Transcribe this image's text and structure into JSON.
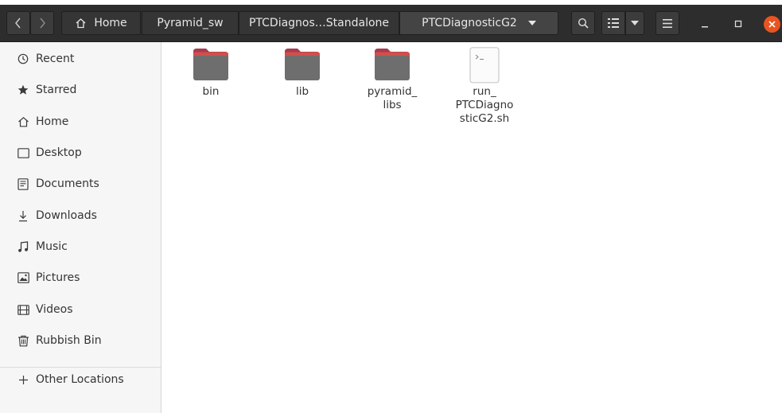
{
  "header": {
    "home_label": "Home",
    "breadcrumbs": [
      "Pyramid_sw",
      "PTCDiagnos…Standalone",
      "PTCDiagnosticG2"
    ]
  },
  "sidebar": {
    "items": [
      {
        "label": "Recent",
        "icon": "recent-icon"
      },
      {
        "label": "Starred",
        "icon": "star-icon"
      },
      {
        "label": "Home",
        "icon": "home-icon"
      },
      {
        "label": "Desktop",
        "icon": "desktop-icon"
      },
      {
        "label": "Documents",
        "icon": "documents-icon"
      },
      {
        "label": "Downloads",
        "icon": "downloads-icon"
      },
      {
        "label": "Music",
        "icon": "music-icon"
      },
      {
        "label": "Pictures",
        "icon": "pictures-icon"
      },
      {
        "label": "Videos",
        "icon": "videos-icon"
      },
      {
        "label": "Rubbish Bin",
        "icon": "trash-icon"
      }
    ],
    "other_locations": "Other Locations"
  },
  "files": [
    {
      "name": "bin",
      "type": "folder"
    },
    {
      "name": "lib",
      "type": "folder"
    },
    {
      "name": "pyramid_\nlibs",
      "type": "folder"
    },
    {
      "name": "run_\nPTCDiagno\nsticG2.sh",
      "type": "script"
    }
  ],
  "colors": {
    "accent": "#e95420",
    "folder_tab": "#a83b52",
    "folder_body": "#6e6e6e",
    "headerbar": "#2d2d2d"
  }
}
